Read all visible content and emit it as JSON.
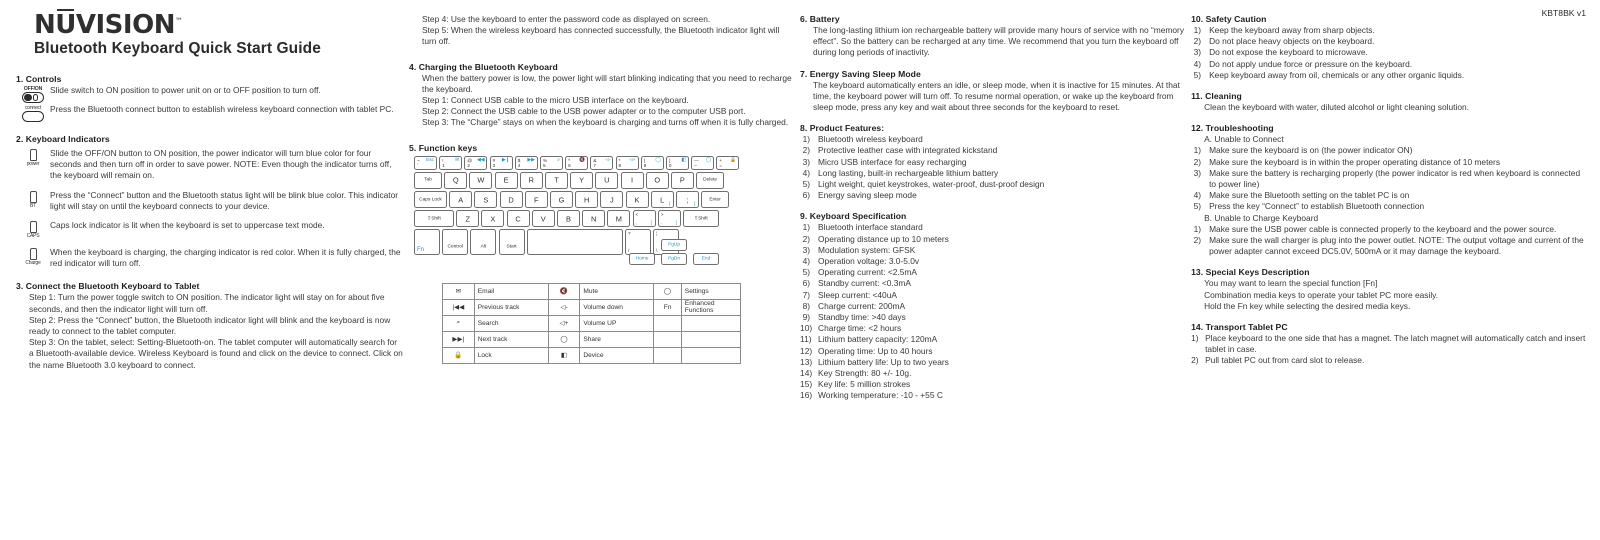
{
  "brand": {
    "logo_part1": "N",
    "logo_part2": "U",
    "logo_part3": "VISION",
    "logo_tm": "™",
    "subtitle": "Bluetooth Keyboard Quick Start Guide",
    "model": "KBT8BK v1",
    "accent_color": "#2196c4"
  },
  "s1": {
    "heading": "1.  Controls",
    "icon1_label": "OFF/ON",
    "icon1_name": "power-slide-switch-icon",
    "text1": "Slide switch to ON position to power unit on or to OFF position to turn off.",
    "icon2_label": "connect",
    "icon2_name": "bluetooth-connect-button-icon",
    "text2": "Press the Bluetooth connect button to establish wireless keyboard connection with tablet PC."
  },
  "s2": {
    "heading": "2. Keyboard Indicators",
    "rows": [
      {
        "label": "power",
        "text": "Slide the OFF/ON button to ON position, the power indicator will turn blue color for four seconds and then turn off in order to save power. NOTE: Even though the indicator turns off, the keyboard will remain on."
      },
      {
        "label": "BT",
        "text": "Press the “Connect” button and the Bluetooth status light will be blink blue color. This indicator light will stay on until the keyboard connects to your device."
      },
      {
        "label": "CAPS",
        "text": "Caps lock indicator is lit when the keyboard is set to uppercase text mode."
      },
      {
        "label": "Charge",
        "text": "When the keyboard is charging, the charging indicator is red color. When it is fully charged, the red indicator will turn off."
      }
    ]
  },
  "s3": {
    "heading": "3. Connect the Bluetooth Keyboard to Tablet",
    "steps": [
      "Step 1: Turn the power toggle switch to ON position. The indicator light will stay on for about five seconds, and then the indicator light will turn off.",
      "Step 2: Press the “Connect” button, the Bluetooth indicator light will blink and the keyboard is now ready to connect to the tablet computer.",
      "Step 3: On the tablet, select: Setting-Bluetooth-on. The tablet computer will automatically search for a Bluetooth-available device. Wireless Keyboard is found and click on the device to connect. Click on the name Bluetooth 3.0 keyboard to connect.",
      "Step 4: Use the keyboard to enter the password code as displayed on screen.",
      "Step 5: When the wireless keyboard has connected successfully, the Bluetooth indicator light will turn off."
    ]
  },
  "s4": {
    "heading": "4. Charging the Bluetooth Keyboard",
    "intro": "When the battery power is low, the power light will start blinking indicating that you need to recharge the keyboard.",
    "steps": [
      "Step 1: Connect USB cable to the micro USB interface on the keyboard.",
      "Step 2: Connect the USB cable to the USB power adapter or to the computer USB port.",
      "Step 3: The “Charge” stays on when the keyboard is charging and turns off when it is fully charged."
    ]
  },
  "s5": {
    "heading": "5. Function keys",
    "keyboard": {
      "row1": [
        {
          "tl": "~",
          "bl": "`",
          "ctr": "Esc",
          "blue_ctr": true
        },
        {
          "tl": "!",
          "bl": "1",
          "tr": "mail"
        },
        {
          "tl": "@",
          "bl": "2",
          "tr": "prev"
        },
        {
          "tl": "#",
          "bl": "3",
          "tr": "play"
        },
        {
          "tl": "$",
          "bl": "4",
          "tr": "next"
        },
        {
          "tl": "%",
          "bl": "5",
          "tr": "search"
        },
        {
          "tl": "^",
          "bl": "6",
          "tr": "mute"
        },
        {
          "tl": "&",
          "bl": "7",
          "tr": "voldn"
        },
        {
          "tl": "*",
          "bl": "8",
          "tr": "volup"
        },
        {
          "tl": "(",
          "bl": "9",
          "tr": "share"
        },
        {
          "tl": ")",
          "bl": "0",
          "tr": "device"
        },
        {
          "tl": "—",
          "bl": "–",
          "tr": "settings"
        },
        {
          "tl": "+",
          "bl": "=",
          "tr": "lock"
        }
      ],
      "row2": [
        "Tab",
        "Q",
        "W",
        "E",
        "R",
        "T",
        "Y",
        "U",
        "I",
        "O",
        "P",
        "Delete"
      ],
      "row3": [
        "Caps Lock",
        "A",
        "S",
        "D",
        "F",
        "G",
        "H",
        "J",
        "K",
        "L",
        ";",
        "Enter"
      ],
      "row4": [
        "Shift",
        "Z",
        "X",
        "C",
        "V",
        "B",
        "N",
        "M",
        ",",
        ".",
        "Shift"
      ],
      "row5": [
        "Fn",
        "Control",
        "Alt",
        "Start",
        "space",
        "?/",
        "|\\"
      ],
      "arrows": {
        "up": "PgUp",
        "left": "Home",
        "down": "PgDn",
        "right": "End"
      }
    },
    "fn_table": [
      {
        "i1": "email-icon",
        "l1": "Email",
        "i2": "mute-icon",
        "l2": "Mute",
        "i3": "settings-icon",
        "l3": "Settings"
      },
      {
        "i1": "prev-track-icon",
        "l1": "Previous track",
        "i2": "volume-down-icon",
        "l2": "Volume down",
        "i3": "Fn",
        "l3": "Enhanced Functions"
      },
      {
        "i1": "search-icon",
        "l1": "Search",
        "i2": "volume-up-icon",
        "l2": "Volume UP",
        "i3": "",
        "l3": ""
      },
      {
        "i1": "next-track-icon",
        "l1": "Next track",
        "i2": "share-icon",
        "l2": "Share",
        "i3": "",
        "l3": ""
      },
      {
        "i1": "lock-icon",
        "l1": "Lock",
        "i2": "device-icon",
        "l2": "Device",
        "i3": "",
        "l3": ""
      }
    ]
  },
  "s6": {
    "heading": "6.  Battery",
    "text": "The long-lasting lithium ion rechargeable battery will provide many hours of service with no “memory effect”. So the battery can be recharged at any time. We recommend that you turn the keyboard off during long periods of inactivity."
  },
  "s7": {
    "heading": "7.  Energy Saving Sleep Mode",
    "text": "The keyboard automatically enters an idle, or sleep mode, when it is inactive for 15 minutes.  At that time, the keyboard power will turn off. To resume normal operation, or wake up the keyboard from sleep mode, press any key and wait about three seconds for the keyboard to reset."
  },
  "s8": {
    "heading": "8.  Product Features:",
    "items": [
      "Bluetooth wireless keyboard",
      "Protective leather case with integrated kickstand",
      "Micro USB interface for easy recharging",
      "Long lasting, built-in rechargeable lithium battery",
      "Light weight, quiet keystrokes, water-proof, dust-proof design",
      "Energy saving sleep mode"
    ]
  },
  "s9": {
    "heading": "9.  Keyboard Specification",
    "items": [
      "Bluetooth interface standard",
      "Operating distance up to 10 meters",
      "Modulation system: GFSK",
      "Operation voltage:  3.0-5.0v",
      "Operating current:  <2.5mA",
      "Standby current:  <0.3mA",
      "Sleep current:  <40uA",
      "Charge current:  200mA",
      "Standby time:  >40 days",
      "Charge time: <2 hours",
      "Lithium battery capacity: 120mA",
      "Operating time:  Up to 40 hours",
      "Lithium battery life: Up to two years",
      "Key Strength: 80 +/- 10g.",
      "Key life:  5 million strokes",
      "Working temperature:  -10 - +55 C"
    ]
  },
  "s10": {
    "heading": "10. Safety Caution",
    "items": [
      "Keep the keyboard away from sharp objects.",
      "Do not place heavy objects on the keyboard.",
      "Do not expose the keyboard to microwave.",
      "Do not apply undue force or pressure on the keyboard.",
      "Keep keyboard away from oil, chemicals or any other organic liquids."
    ]
  },
  "s11": {
    "heading": "11. Cleaning",
    "text": "Clean the keyboard with water, diluted alcohol or light cleaning solution."
  },
  "s12": {
    "heading": "12. Troubleshooting",
    "sub_a": "A. Unable to Connect",
    "a_items": [
      "Make sure the keyboard is on (the power indicator ON)",
      "Make sure the keyboard is in within the proper operating distance of 10 meters",
      "Make sure the battery is recharging properly (the power indicator is red when keyboard is connected to power line)",
      "Make sure the Bluetooth setting on the tablet PC is on",
      "Press the key “Connect” to establish Bluetooth connection"
    ],
    "sub_b": "B. Unable to Charge Keyboard",
    "b_items": [
      "Make sure the USB power cable is connected properly to the keyboard and the power source.",
      "Make sure the wall charger is plug into the power outlet. NOTE: The output voltage and current of the power adapter cannot exceed DC5.0V, 500mA or it may damage the keyboard."
    ]
  },
  "s13": {
    "heading": "13. Special Keys Description",
    "lines": [
      "You may want to learn the special function [Fn]",
      "Combination media keys to operate your tablet PC more easily.",
      "Hold the Fn key while selecting the desired media keys."
    ]
  },
  "s14": {
    "heading": "14. Transport Tablet PC",
    "items": [
      "Place keyboard to the one side that has a magnet. The latch magnet will automatically catch and insert tablet in case.",
      "Pull tablet PC out from card slot to release."
    ]
  }
}
